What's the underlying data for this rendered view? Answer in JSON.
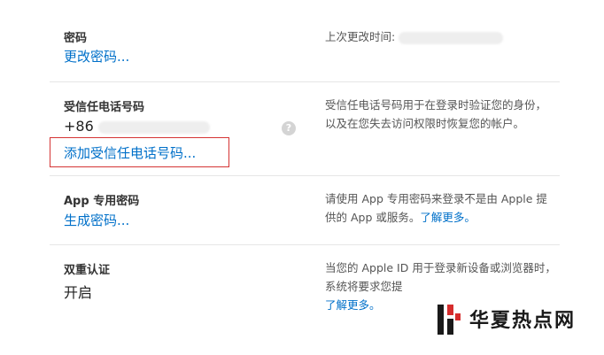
{
  "password": {
    "label": "密码",
    "link": "更改密码...",
    "desc_prefix": "上次更改时间:"
  },
  "trusted_phone": {
    "label": "受信任电话号码",
    "number_prefix": "+86",
    "add_link": "添加受信任电话号码...",
    "info_icon": "?",
    "desc": "受信任电话号码用于在登录时验证您的身份，以及在您失去访问权限时恢复您的帐户。"
  },
  "app_password": {
    "label": "App 专用密码",
    "link": "生成密码...",
    "desc": "请使用 App 专用密码来登录不是由 Apple 提供的 App 或服务。",
    "learn_more": "了解更多。"
  },
  "two_factor": {
    "label": "双重认证",
    "status": "开启",
    "desc": "当您的 Apple ID 用于登录新设备或浏览器时，系统将要求您提",
    "learn_more": "了解更多。"
  },
  "watermark": {
    "text": "华夏热点网"
  },
  "colors": {
    "link": "#0070c9",
    "highlight_border": "#d53434",
    "divider": "#e6e6e6"
  }
}
